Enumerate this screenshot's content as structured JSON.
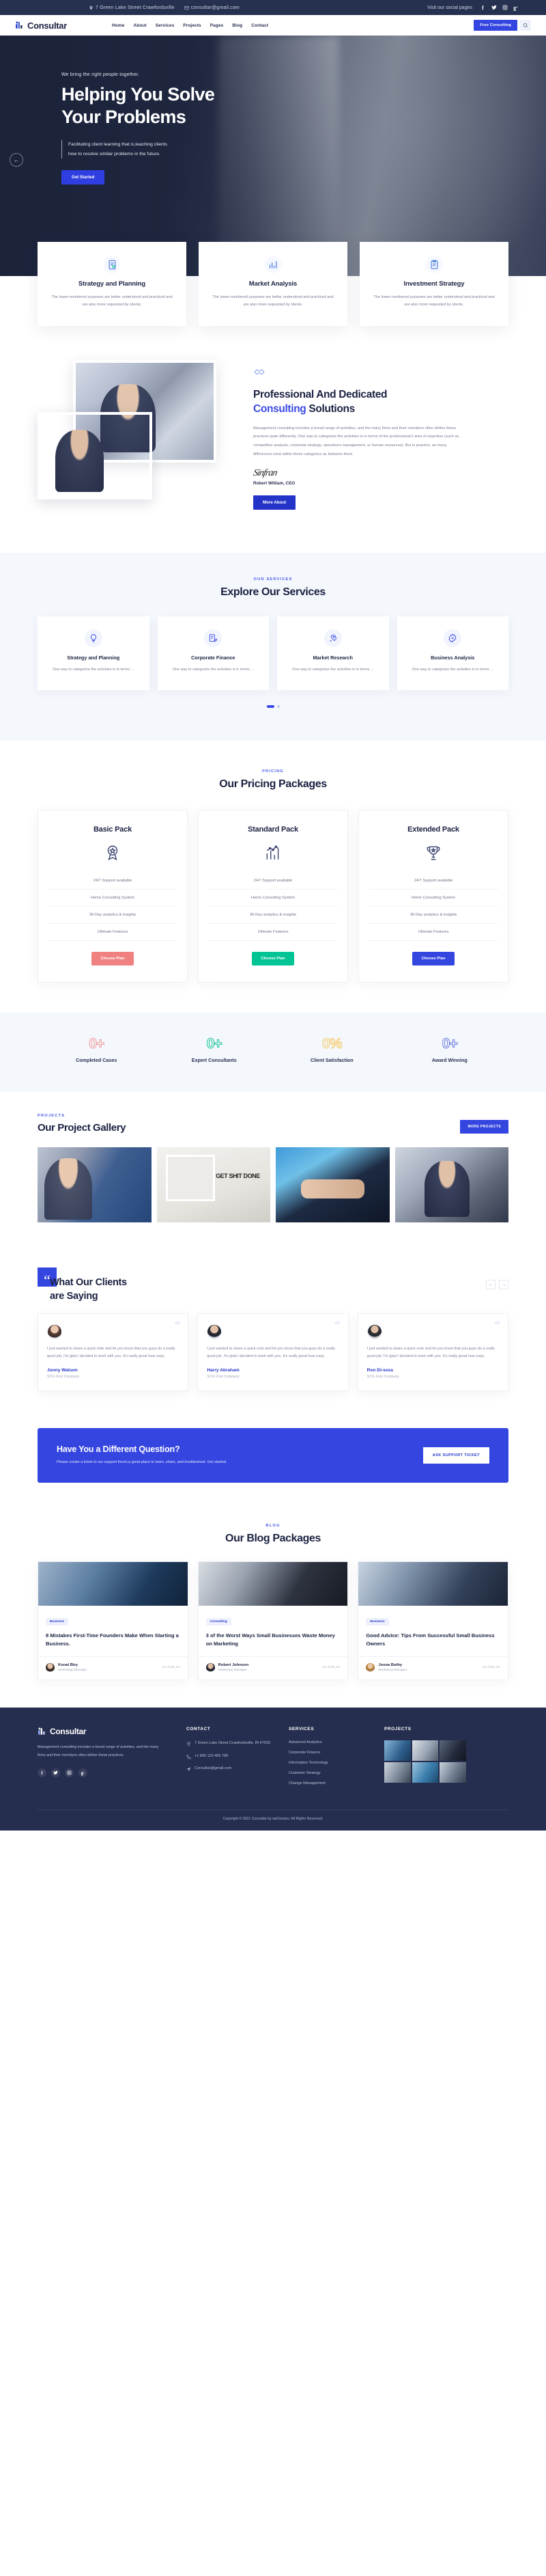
{
  "topbar": {
    "address": "7 Green Lake Street Crawfordsville",
    "email": "consultar@gmail.com",
    "social_label": "Visit our social pages",
    "socials": [
      "f",
      "t",
      "in",
      "g+"
    ]
  },
  "header": {
    "brand": "Consultar",
    "nav": [
      "Home",
      "About",
      "Services",
      "Projects",
      "Pages",
      "Blog",
      "Contact"
    ],
    "cta": "Free Consulting"
  },
  "hero": {
    "eyebrow": "We bring the right people together.",
    "title_line1": "Helping You Solve",
    "title_line2": "Your Problems",
    "subtitle_line1": "Facilitating client learning that is,teaching clients",
    "subtitle_line2": "how to resolve similar problems in the future.",
    "button": "Get Started"
  },
  "features": [
    {
      "title": "Strategy and Planning",
      "desc": "The lower-numbered purposes are better understood and practiced and are also more requested by clients.",
      "icon": "document-chart-icon"
    },
    {
      "title": "Market Analysis",
      "desc": "The lower-numbered purposes are better understood and practiced and are also more requested by clients.",
      "icon": "bar-chart-icon"
    },
    {
      "title": "Investment Strategy",
      "desc": "The lower-numbered purposes are better understood and practiced and are also more requested by clients.",
      "icon": "clipboard-icon"
    }
  ],
  "about": {
    "title_part1": "Professional And Dedicated",
    "title_highlight": "Consulting",
    "title_part2": "Solutions",
    "paragraph": "Management consulting includes a broad range of activities, and the many firms and their members often define these practices quite differently. One way to categorize the activities is in terms of the professional's area of expertise (such as competitive analysis, corporate strategy, operations management, or human resources). But in practice, as many differences exist within these categories as between them.",
    "signature": "Sinfran",
    "signer": "Robert William, CEO",
    "button": "More About"
  },
  "services": {
    "eyebrow": "OUR SERVICES",
    "title": "Explore Our Services",
    "items": [
      {
        "title": "Strategy and Planning",
        "desc": "One way to categorize the activities is in terms ...",
        "icon": "lightbulb-icon"
      },
      {
        "title": "Corporate Finance",
        "desc": "One way to categorize the activities is in terms ...",
        "icon": "clipboard-pencil-icon"
      },
      {
        "title": "Market Research",
        "desc": "One way to categorize the activities is in terms ...",
        "icon": "rocket-icon"
      },
      {
        "title": "Business Analysis",
        "desc": "One way to categorize the activities is in terms ...",
        "icon": "gear-chart-icon"
      }
    ]
  },
  "pricing": {
    "eyebrow": "PRICING",
    "title": "Our Pricing Packages",
    "features": [
      "24/7 Support available",
      "Home Consulting System",
      "30-Day analytics & insights",
      "Ultimate Features"
    ],
    "plans": [
      {
        "name": "Basic Pack",
        "icon": "badge-star-icon",
        "button": "Choose Plan",
        "color": "#f08181"
      },
      {
        "name": "Standard Pack",
        "icon": "bar-line-chart-icon",
        "button": "Choose Plan",
        "color": "#03c494"
      },
      {
        "name": "Extended Pack",
        "icon": "trophy-icon",
        "button": "Choose Plan",
        "color": "#3445e0"
      }
    ]
  },
  "counters": [
    {
      "value": "0+",
      "label": "Completed Cases",
      "color": "#f09a9a"
    },
    {
      "value": "0+",
      "label": "Expert Consultants",
      "color": "#19c39a"
    },
    {
      "value": "0%",
      "label": "Client Satisfaction",
      "color": "#f5cc6a"
    },
    {
      "value": "0+",
      "label": "Award Winning",
      "color": "#6a7ae0"
    }
  ],
  "projects": {
    "eyebrow": "PROJECTS",
    "title": "Our Project Gallery",
    "button": "MORE PROJECTS",
    "thumbs": [
      "project-thumb-meeting",
      "project-thumb-getshitdone",
      "project-thumb-handshake",
      "project-thumb-office"
    ]
  },
  "testimonials": {
    "title_line1": "What Our Clients",
    "title_line2": "are Saying",
    "quote_glyph": "“",
    "prev": "←",
    "next": "→",
    "items": [
      {
        "quote": "I just wanted to share a quick note and let you know that you guys do a really good job. I'm glad I decided to work with you. It's really great how easy.",
        "name": "Jonny Watson",
        "company": "SCG First Company"
      },
      {
        "quote": "I just wanted to share a quick note and let you know that you guys do a really good job. I'm glad I decided to work with you. It's really great how easy.",
        "name": "Harry Abraham",
        "company": "SCG First Company"
      },
      {
        "quote": "I just wanted to share a quick note and let you know that you guys do a really good job. I'm glad I decided to work with you. It's really great how easy.",
        "name": "Ron Di-soza",
        "company": "SCG First Company"
      }
    ]
  },
  "cta": {
    "title": "Have You a Different Question?",
    "desc": "Please create a ticket to our support forum,a great place to learn, share, and troubleshoot. Get started.",
    "button": "ASK SUPPORT TICKET"
  },
  "blog": {
    "eyebrow": "BLOG",
    "title": "Our Blog Packages",
    "posts": [
      {
        "badge": "Business",
        "title": "8 Mistakes First-Time Founders Make When Starting a Business.",
        "author": "Konal Biry",
        "role": "Marketing Manager",
        "date": "14 AUG,21"
      },
      {
        "badge": "Consulting",
        "title": "3 of the Worst Ways Small Businesses Waste Money on Marketing",
        "author": "Robert Johnson",
        "role": "Marketing Manager",
        "date": "14 AUG,21"
      },
      {
        "badge": "Business",
        "title": "Good Advice: Tips From Successful Small Business Owners",
        "author": "Josna Bothy",
        "role": "Marketing Manager",
        "date": "14 AUG,21"
      }
    ]
  },
  "footer": {
    "brand": "Consultar",
    "desc": "Management consulting includes a broad range of activities, and the many firms and their members often define these practices.",
    "socials": [
      "f",
      "t",
      "in",
      "g+"
    ],
    "contact_heading": "CONTACT",
    "contact": [
      {
        "icon": "location-pin-icon",
        "text": "7 Green Lake Street Crawfordsville, IN 47933"
      },
      {
        "icon": "phone-icon",
        "text": "+1 800 123 456 789"
      },
      {
        "icon": "paper-plane-icon",
        "text": "Consultar@gmail.com"
      }
    ],
    "services_heading": "SERVICES",
    "services": [
      "Advanced Analytics",
      "Corporate Finance",
      "Information Technology",
      "Customer Strategy",
      "Change Management"
    ],
    "projects_heading": "PROJECTS",
    "copyright": "Copyright © 2021 Consultar by wpOceans. All Rights Reserved."
  }
}
